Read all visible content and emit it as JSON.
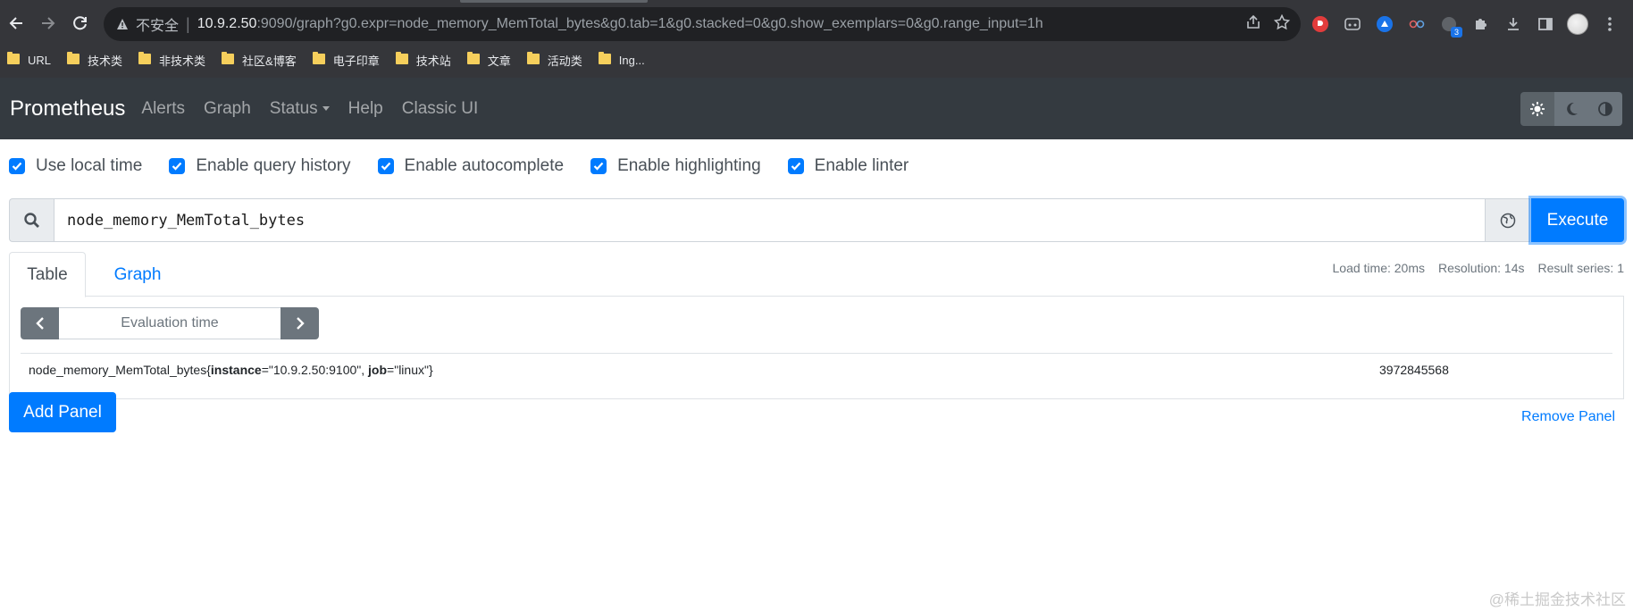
{
  "browser": {
    "security_label": "不安全",
    "url_host": "10.9.2.50",
    "url_rest": ":9090/graph?g0.expr=node_memory_MemTotal_bytes&g0.tab=1&g0.stacked=0&g0.show_exemplars=0&g0.range_input=1h",
    "extension_badge": "3",
    "bookmarks": [
      "URL",
      "技术类",
      "非技术类",
      "社区&博客",
      "电子印章",
      "技术站",
      "文章",
      "活动类",
      "Ing..."
    ]
  },
  "navbar": {
    "brand": "Prometheus",
    "links": [
      "Alerts",
      "Graph",
      "Status",
      "Help",
      "Classic UI"
    ]
  },
  "options": [
    {
      "label": "Use local time",
      "checked": true
    },
    {
      "label": "Enable query history",
      "checked": true
    },
    {
      "label": "Enable autocomplete",
      "checked": true
    },
    {
      "label": "Enable highlighting",
      "checked": true
    },
    {
      "label": "Enable linter",
      "checked": true
    }
  ],
  "query": {
    "expression": "node_memory_MemTotal_bytes",
    "execute_label": "Execute"
  },
  "panel": {
    "tabs": [
      "Table",
      "Graph"
    ],
    "stats": {
      "load_time": "Load time: 20ms",
      "resolution": "Resolution: 14s",
      "result_series": "Result series: 1"
    },
    "eval_placeholder": "Evaluation time",
    "result": {
      "metric": "node_memory_MemTotal_bytes",
      "open": "{",
      "label1_key": "instance",
      "label1_val": "=\"10.9.2.50:9100\", ",
      "label2_key": "job",
      "label2_val": "=\"linux\"",
      "close": "}",
      "value": "3972845568"
    },
    "remove_label": "Remove Panel"
  },
  "add_panel_label": "Add Panel",
  "watermark": "@稀土掘金技术社区",
  "colors": {
    "primary": "#007bff",
    "navbar": "#343a40",
    "secondary": "#6c757d"
  }
}
